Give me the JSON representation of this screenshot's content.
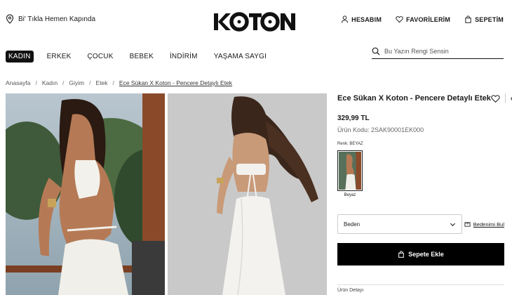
{
  "header": {
    "delivery_text": "Bi' Tıkla Hemen Kapında",
    "logo_text": "KOTON",
    "account_label": "HESABIM",
    "favorites_label": "FAVORİLERİM",
    "cart_label": "SEPETİM"
  },
  "nav": {
    "categories": [
      "KADIN",
      "ERKEK",
      "ÇOCUK",
      "BEBEK",
      "İNDİRİM",
      "YAŞAMA SAYGI"
    ],
    "active": "KADIN"
  },
  "search": {
    "placeholder": "Bu Yazın Rengi Sensin"
  },
  "breadcrumb": [
    "Anasayfa",
    "Kadın",
    "Giyim",
    "Etek",
    "Ece Sükan X Koton - Pencere Detaylı Etek"
  ],
  "product": {
    "title": "Ece Sükan X Koton - Pencere Detaylı Etek",
    "price": "329,99 TL",
    "code": "Ürün Kodu: 2SAK90001EK000",
    "color_label": "Renk: BEYAZ",
    "swatch_name": "Beyaz",
    "size_placeholder": "Beden",
    "size_guide_label": "Bedenimi Bul",
    "add_to_cart_label": "Sepete Ekle",
    "more_label": "Ürün Detayı"
  },
  "colors": {
    "accent": "#000000",
    "text": "#1a1a1a",
    "muted": "#666666"
  }
}
